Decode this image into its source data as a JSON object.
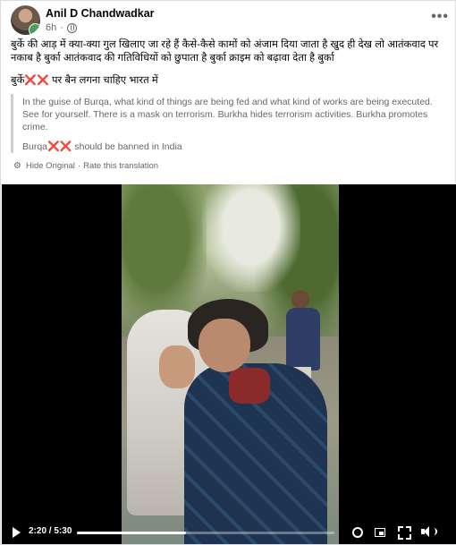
{
  "post": {
    "author": "Anil D Chandwadkar",
    "time": "6h",
    "more": "•••",
    "original_text": "बुर्के की आड़ में क्या-क्या गुल खिलाए जा रहे हैं कैसे-कैसे कामों को अंजाम दिया जाता है खुद ही देख लो आतंकवाद पर नकाब है बुर्का आतंकवाद की गतिविधियों को छुपाता है बुर्का क्राइम को बढ़ावा देता है बुर्का",
    "original_line2_prefix": "बुर्के",
    "original_line2_marks": "❌❌",
    "original_line2_suffix": " पर बैन लगना चाहिए भारत में"
  },
  "translation": {
    "text": "In the guise of Burqa, what kind of things are being fed and what kind of works are being executed. See for yourself. There is a mask on terrorism. Burkha hides terrorism activities. Burkha promotes crime.",
    "line2_prefix": "Burqa",
    "line2_marks": "❌❌",
    "line2_suffix": " should be banned in India",
    "hide_original": "Hide Original",
    "separator": "·",
    "rate": "Rate this translation"
  },
  "video": {
    "current_time": "2:20",
    "duration": "5:30",
    "time_sep": " / ",
    "progress": 0.424
  },
  "colors": {
    "meta_gray": "#65676b",
    "text": "#050505",
    "video_bg": "#000000",
    "cross": "#e0245e"
  },
  "icons": [
    "globe-icon",
    "more-icon",
    "gear-icon",
    "play-icon",
    "settings-icon",
    "pip-icon",
    "fullscreen-icon",
    "volume-icon"
  ]
}
